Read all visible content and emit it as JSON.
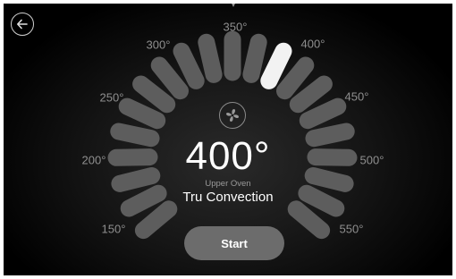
{
  "header": {
    "back_icon": "arrow-left-icon"
  },
  "dial": {
    "scale_labels": [
      "150°",
      "200°",
      "250°",
      "300°",
      "350°",
      "400°",
      "450°",
      "500°",
      "550°"
    ],
    "selected_value": "400°",
    "segment_count": 21,
    "selected_segment_index": 12,
    "colors": {
      "segment": "#5d5d5d",
      "selected": "#f2f2f2",
      "selected_outline": "#ffffff"
    }
  },
  "center": {
    "mode_icon": "fan-icon",
    "temperature": "400°",
    "oven_label": "Upper Oven",
    "mode_label": "Tru Convection"
  },
  "actions": {
    "start_label": "Start"
  }
}
